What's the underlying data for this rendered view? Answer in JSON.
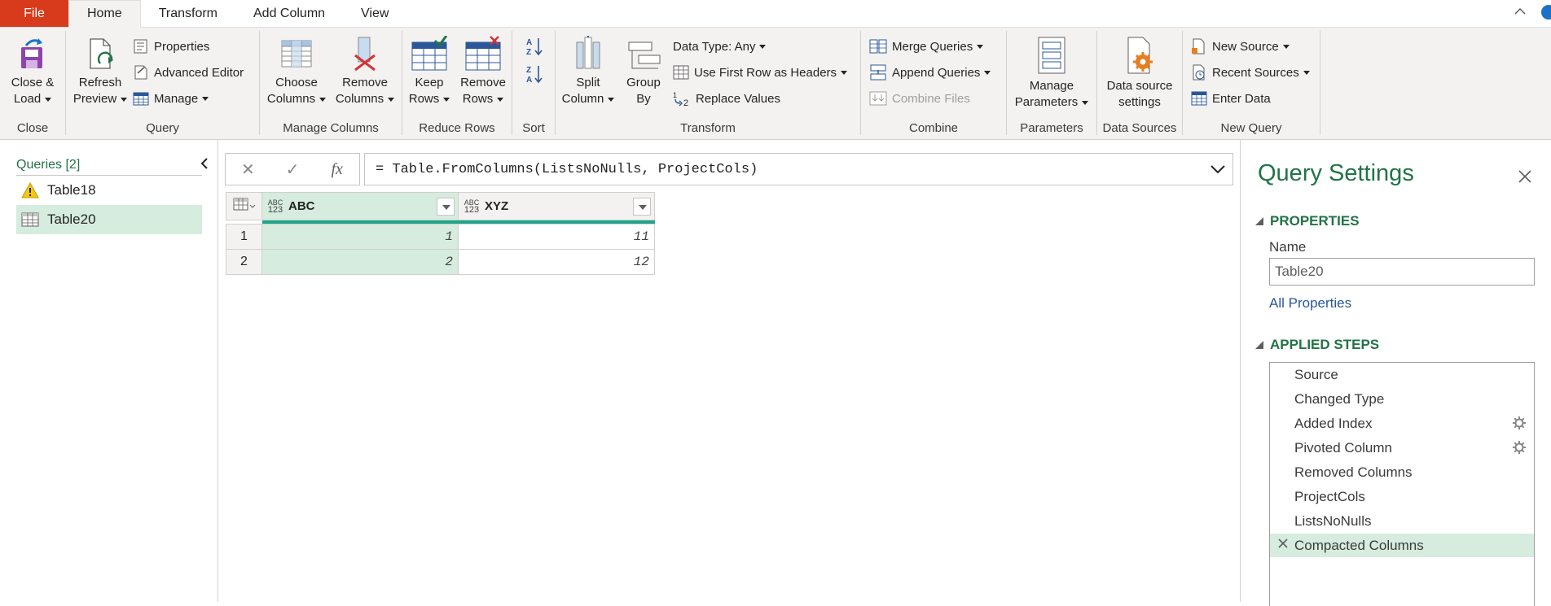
{
  "tabs": [
    {
      "label": "File"
    },
    {
      "label": "Home"
    },
    {
      "label": "Transform"
    },
    {
      "label": "Add Column"
    },
    {
      "label": "View"
    }
  ],
  "ribbon": {
    "close": {
      "btn": "Close &",
      "btn2": "Load",
      "group": "Close"
    },
    "query": {
      "refresh": "Refresh",
      "refresh2": "Preview",
      "properties": "Properties",
      "advanced_editor": "Advanced Editor",
      "manage": "Manage",
      "group": "Query"
    },
    "manage_columns": {
      "choose": "Choose",
      "choose2": "Columns",
      "remove": "Remove",
      "remove2": "Columns",
      "group": "Manage Columns"
    },
    "reduce_rows": {
      "keep": "Keep",
      "keep2": "Rows",
      "remove": "Remove",
      "remove2": "Rows",
      "group": "Reduce Rows"
    },
    "sort": {
      "group": "Sort"
    },
    "transform": {
      "split": "Split",
      "split2": "Column",
      "groupby": "Group",
      "groupby2": "By",
      "data_type": "Data Type: Any",
      "first_row": "Use First Row as Headers",
      "replace": "Replace Values",
      "group": "Transform"
    },
    "combine": {
      "merge": "Merge Queries",
      "append": "Append Queries",
      "combine_files": "Combine Files",
      "group": "Combine"
    },
    "parameters": {
      "manage": "Manage",
      "manage2": "Parameters",
      "group": "Parameters"
    },
    "data_sources": {
      "settings": "Data source",
      "settings2": "settings",
      "group": "Data Sources"
    },
    "new_query": {
      "new_source": "New Source",
      "recent": "Recent Sources",
      "enter": "Enter Data",
      "group": "New Query"
    }
  },
  "queries": {
    "header": "Queries [2]",
    "items": [
      {
        "label": "Table18",
        "icon": "warning-icon"
      },
      {
        "label": "Table20",
        "icon": "table-icon",
        "selected": true
      }
    ]
  },
  "formula": {
    "cancel": "✕",
    "commit": "✓",
    "fx": "fx",
    "text": "= Table.FromColumns(ListsNoNulls, ProjectCols)"
  },
  "grid": {
    "type_label_top": "ABC",
    "type_label_bottom": "123",
    "columns": [
      "ABC",
      "XYZ"
    ],
    "rows": [
      {
        "n": "1",
        "abc": "1",
        "xyz": "11"
      },
      {
        "n": "2",
        "abc": "2",
        "xyz": "12"
      }
    ]
  },
  "settings": {
    "title": "Query Settings",
    "properties_header": "PROPERTIES",
    "name_label": "Name",
    "name_value": "Table20",
    "all_properties": "All Properties",
    "steps_header": "APPLIED STEPS",
    "steps": [
      {
        "label": "Source"
      },
      {
        "label": "Changed Type"
      },
      {
        "label": "Added Index",
        "gear": true
      },
      {
        "label": "Pivoted Column",
        "gear": true
      },
      {
        "label": "Removed Columns"
      },
      {
        "label": "ProjectCols"
      },
      {
        "label": "ListsNoNulls"
      },
      {
        "label": "Compacted Columns",
        "selected": true
      }
    ]
  },
  "colors": {
    "accent": "#217346",
    "file_tab": "#d83b1b",
    "selection": "#d5ecdf",
    "column_bar": "#1fa58a"
  }
}
